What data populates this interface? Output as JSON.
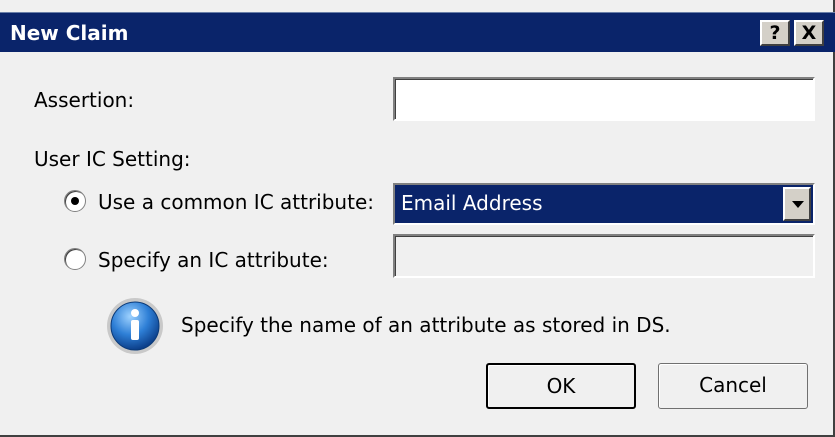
{
  "window": {
    "title": "New Claim",
    "help_label": "?",
    "close_label": "X"
  },
  "form": {
    "assertion_label": "Assertion:",
    "assertion_value": "",
    "user_ic_setting_label": "User IC Setting:",
    "common_ic_label": "Use a common IC attribute:",
    "common_ic_selected": true,
    "common_ic_value": "Email Address",
    "specify_ic_label": "Specify an IC attribute:",
    "specify_ic_selected": false,
    "specify_ic_value": "",
    "info_text": "Specify the name of an attribute as stored in DS."
  },
  "buttons": {
    "ok_label": "OK",
    "cancel_label": "Cancel"
  },
  "colors": {
    "titlebar": "#0a246a",
    "selection": "#0a246a"
  },
  "icons": {
    "info": "info-icon",
    "dropdown": "chevron-down-icon"
  }
}
